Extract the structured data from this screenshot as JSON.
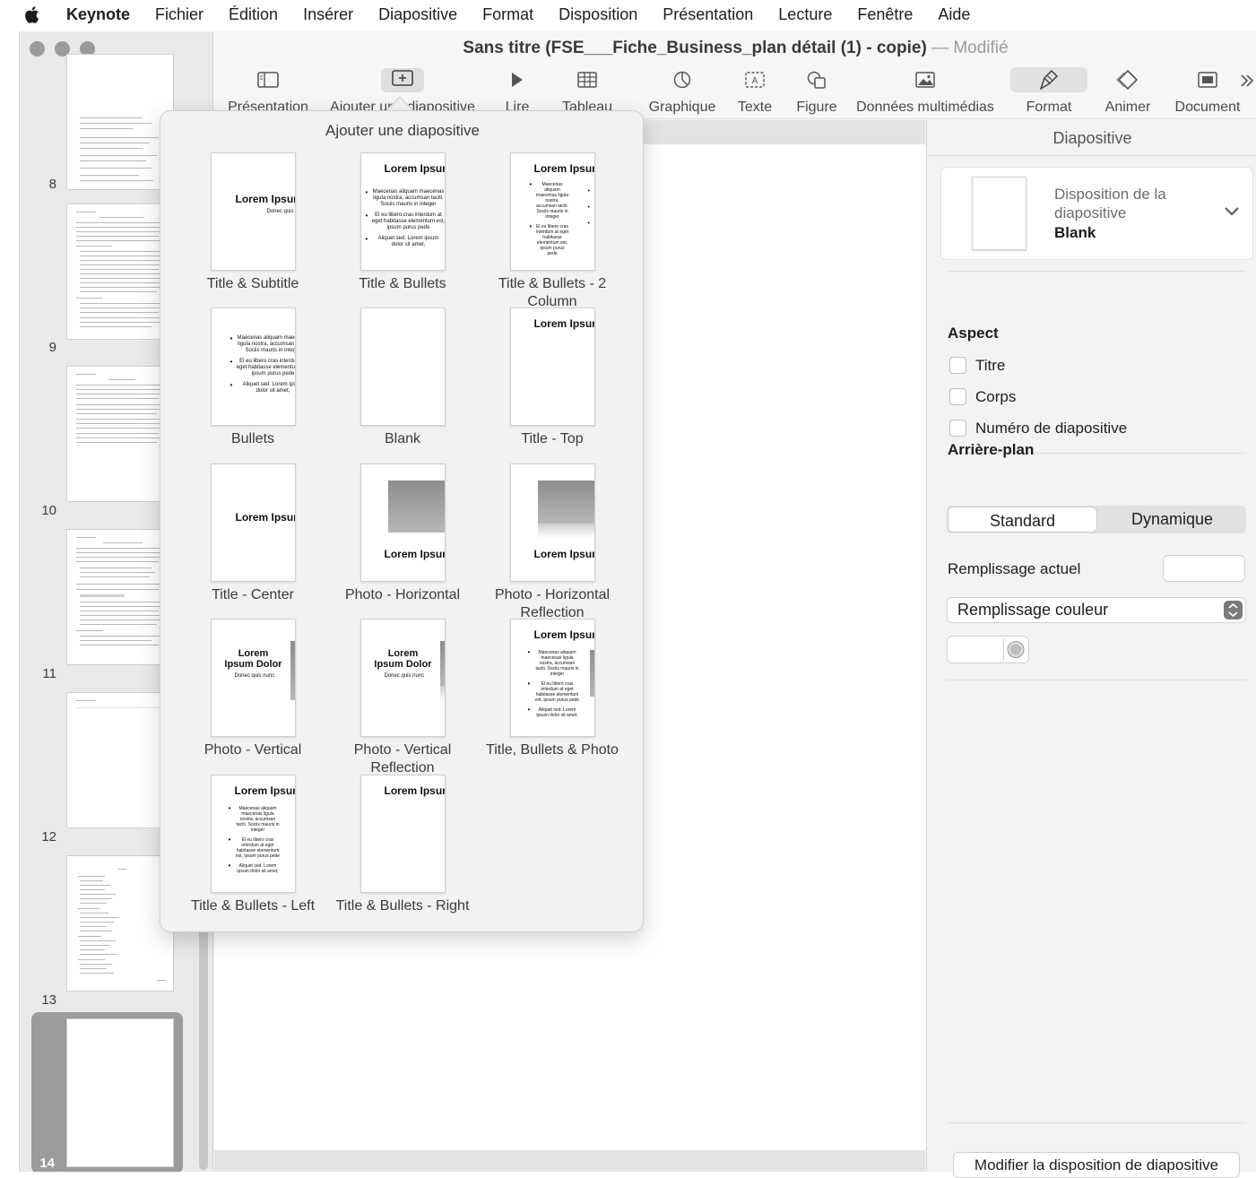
{
  "menubar": {
    "app": "Keynote",
    "items": [
      "Fichier",
      "Édition",
      "Insérer",
      "Diapositive",
      "Format",
      "Disposition",
      "Présentation",
      "Lecture",
      "Fenêtre",
      "Aide"
    ]
  },
  "window": {
    "title": "Sans titre (FSE___Fiche_Business_plan détail (1) - copie)",
    "separator": "—",
    "status": "Modifié"
  },
  "toolbar": {
    "items": [
      {
        "label": "Présentation",
        "icon": "sidebar-icon"
      },
      {
        "label": "Ajouter une diapositive",
        "icon": "add-slide-icon"
      },
      {
        "label": "Lire",
        "icon": "play-icon"
      },
      {
        "label": "Tableau",
        "icon": "table-icon"
      },
      {
        "label": "Graphique",
        "icon": "chart-icon"
      },
      {
        "label": "Texte",
        "icon": "text-icon"
      },
      {
        "label": "Figure",
        "icon": "shape-icon"
      },
      {
        "label": "Données multimédias",
        "icon": "media-icon"
      },
      {
        "label": "Format",
        "icon": "format-brush-icon"
      },
      {
        "label": "Animer",
        "icon": "animate-icon"
      },
      {
        "label": "Document",
        "icon": "document-icon"
      }
    ]
  },
  "sidebar": {
    "slides": [
      "8",
      "9",
      "10",
      "11",
      "12",
      "13",
      "14"
    ],
    "selected": "14"
  },
  "popover": {
    "title": "Ajouter une diapositive",
    "lorem": "Lorem Ipsum",
    "lorem_dolor": "Lorem Ipsum Dolor",
    "donec": "Donec quis nunc",
    "bullets": [
      "Maecenas aliquam maecenas ligula nostra, accumsan taciti. Sociis mauris in integer",
      "El eu libero cras interdum at eget habitasse elementum est, ipsum purus pede",
      "Aliquet sed. Lorem ipsum dolor sit amet,"
    ],
    "layouts": [
      "Title & Subtitle",
      "Title & Bullets",
      "Title & Bullets - 2 Column",
      "Bullets",
      "Blank",
      "Title - Top",
      "Title - Center",
      "Photo - Horizontal",
      "Photo - Horizontal Reflection",
      "Photo - Vertical",
      "Photo - Vertical Reflection",
      "Title, Bullets & Photo",
      "Title & Bullets - Left",
      "Title & Bullets - Right"
    ]
  },
  "inspector": {
    "header": "Diapositive",
    "layout_label": "Disposition de la diapositive",
    "layout_value": "Blank",
    "aspect_title": "Aspect",
    "aspect_options": [
      "Titre",
      "Corps",
      "Numéro de diapositive"
    ],
    "background_title": "Arrière-plan",
    "bg_segments": [
      "Standard",
      "Dynamique"
    ],
    "current_fill_label": "Remplissage actuel",
    "fill_type": "Remplissage couleur",
    "modify_button": "Modifier la disposition de diapositive"
  }
}
